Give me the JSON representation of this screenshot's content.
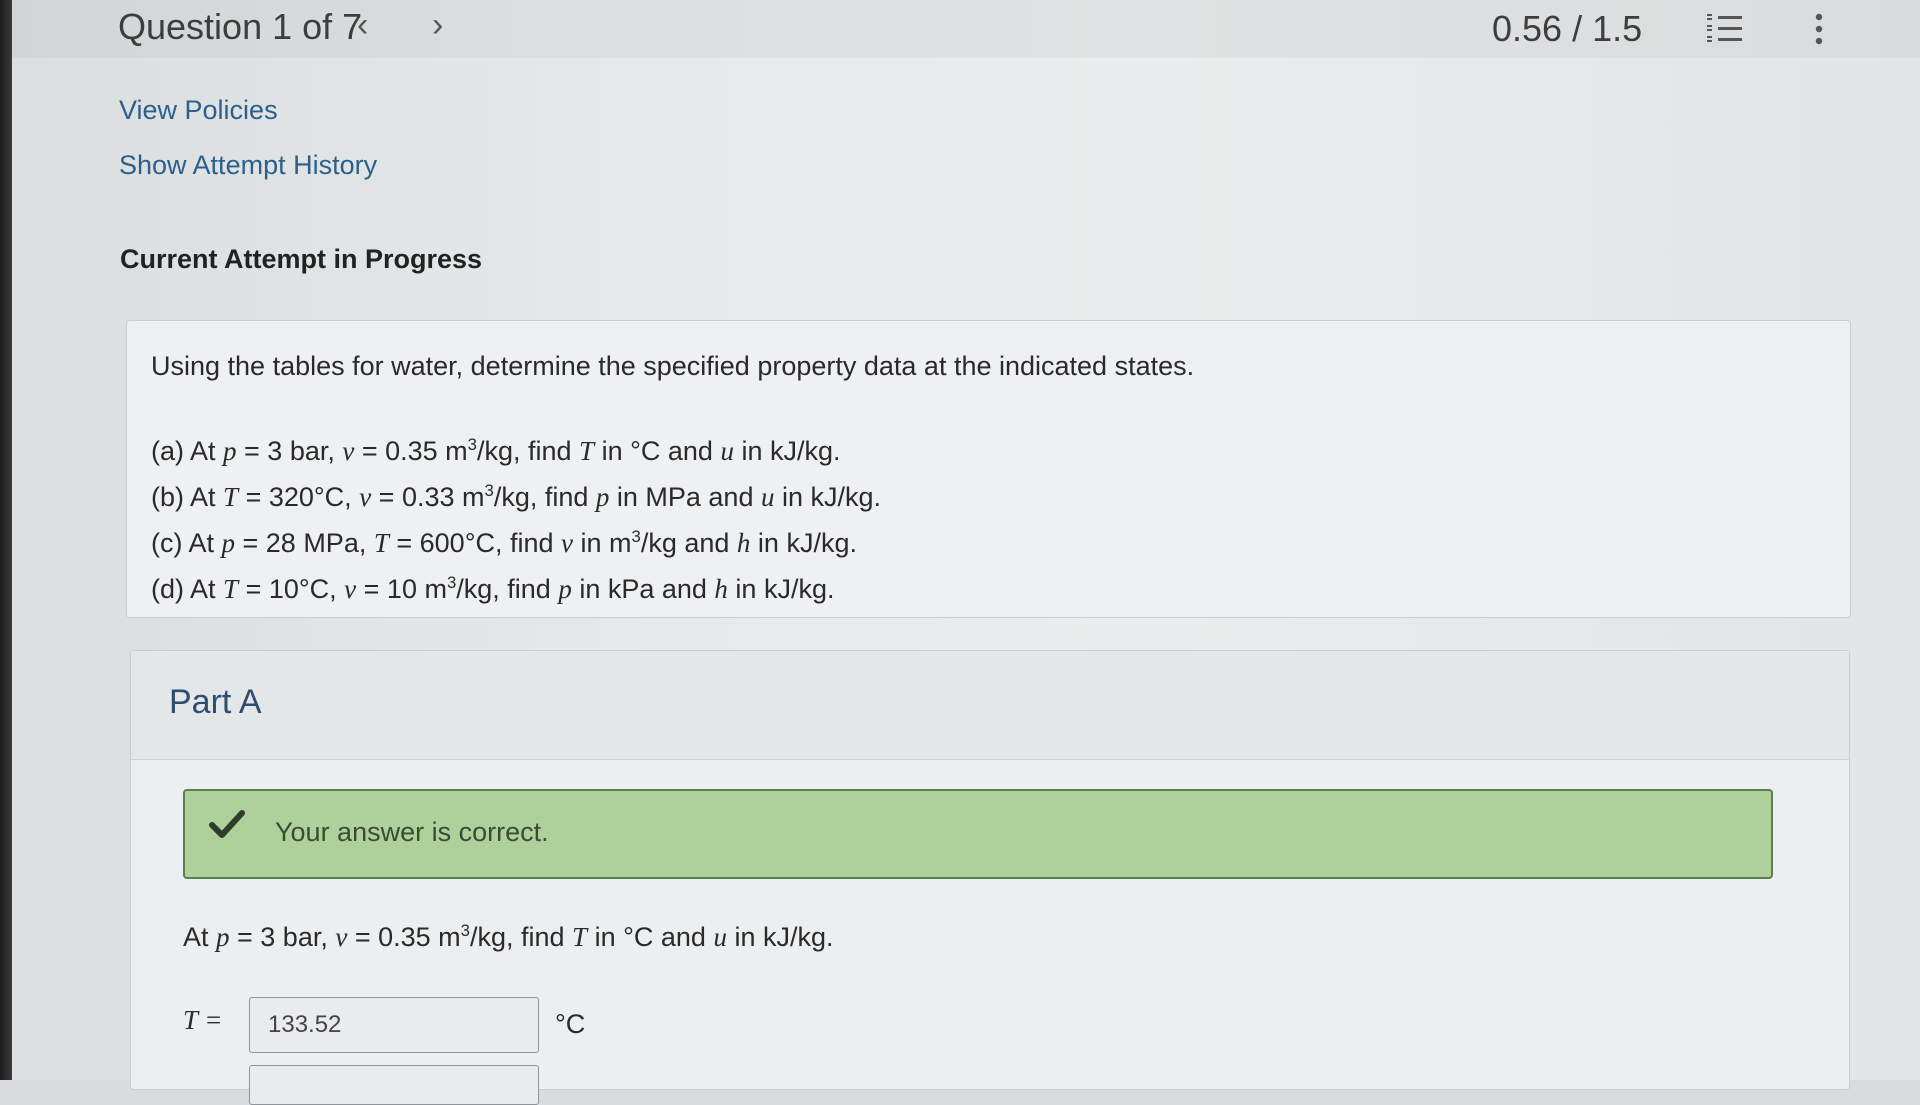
{
  "header": {
    "question_title": "Question 1 of 7",
    "prev_arrow": "‹",
    "next_arrow": "›",
    "score": "0.56 / 1.5",
    "list_icon": "numbered-list-icon",
    "menu_icon": "kebab-menu-icon"
  },
  "links": {
    "view_policies": "View Policies",
    "attempt_history": "Show Attempt History"
  },
  "attempt_status": "Current Attempt in Progress",
  "problem": {
    "intro": "Using the tables for water, determine the specified property data at the indicated states.",
    "parts": {
      "a": {
        "label": "(a) At ",
        "p_val": " = 3 bar, ",
        "v_val": " = 0.35 m",
        "exp": "3",
        "tail1": "/kg, find ",
        "tail2": " in °C and ",
        "tail3": " in kJ/kg."
      },
      "b": {
        "label": "(b) At ",
        "t_val": " = 320°C, ",
        "v_val": " = 0.33 m",
        "exp": "3",
        "tail1": "/kg, find ",
        "tail2": " in MPa and ",
        "tail3": " in kJ/kg."
      },
      "c": {
        "label": "(c) At ",
        "p_val": " = 28 MPa, ",
        "t_val": " = 600°C, find ",
        "tail1": " in m",
        "exp": "3",
        "tail2": "/kg and ",
        "tail3": " in kJ/kg."
      },
      "d": {
        "label": "(d) At ",
        "t_val": " = 10°C, ",
        "v_val": " = 10 m",
        "exp": "3",
        "tail1": "/kg, find ",
        "tail2": " in kPa and ",
        "tail3": " in kJ/kg."
      }
    }
  },
  "part_a": {
    "title": "Part A",
    "feedback": "Your answer is correct.",
    "question": {
      "lead": "At ",
      "p_val": " = 3 bar, ",
      "v_val": " = 0.35 m",
      "exp": "3",
      "tail1": "/kg, find ",
      "tail2": " in °C and ",
      "tail3": " in kJ/kg."
    },
    "answer_t_label": "T =",
    "answer_t_value": "133.52",
    "answer_t_unit": "°C"
  },
  "colors": {
    "link": "#2d5e8c",
    "success_bg": "#aed09a",
    "success_border": "#5e7d52"
  }
}
